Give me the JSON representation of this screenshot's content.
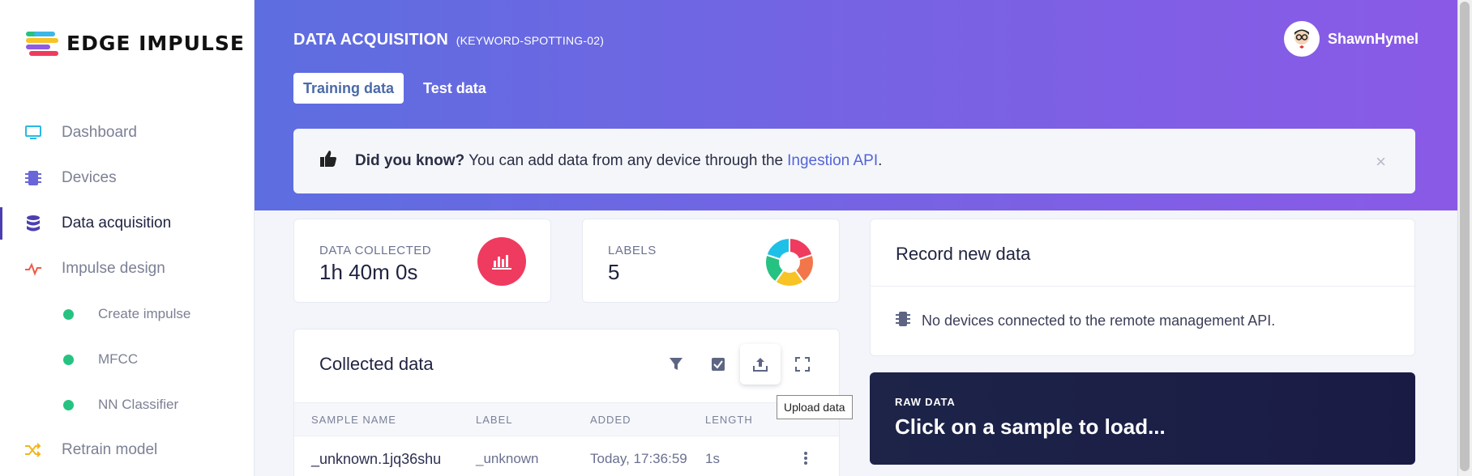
{
  "brand": {
    "name": "EDGE IMPULSE"
  },
  "sidebar": {
    "items": [
      {
        "label": "Dashboard",
        "icon": "monitor-icon"
      },
      {
        "label": "Devices",
        "icon": "chip-icon"
      },
      {
        "label": "Data acquisition",
        "icon": "database-icon",
        "active": true
      },
      {
        "label": "Impulse design",
        "icon": "pulse-icon"
      },
      {
        "label": "Retrain model",
        "icon": "shuffle-icon"
      }
    ],
    "sub_items": [
      {
        "label": "Create impulse"
      },
      {
        "label": "MFCC"
      },
      {
        "label": "NN Classifier"
      }
    ]
  },
  "header": {
    "title": "DATA ACQUISITION",
    "project": "(KEYWORD-SPOTTING-02)",
    "user": "ShawnHymel",
    "tabs": [
      {
        "label": "Training data",
        "active": true
      },
      {
        "label": "Test data",
        "active": false
      }
    ]
  },
  "tip": {
    "bold": "Did you know?",
    "text": "You can add data from any device through the",
    "link": "Ingestion API",
    "end": ".",
    "close": "×"
  },
  "stats": {
    "collected_label": "DATA COLLECTED",
    "collected_value": "1h 40m 0s",
    "labels_label": "LABELS",
    "labels_value": "5"
  },
  "record": {
    "title": "Record new data",
    "message": "No devices connected to the remote management API."
  },
  "raw": {
    "label": "RAW DATA",
    "title": "Click on a sample to load..."
  },
  "collected": {
    "title": "Collected data",
    "tooltip": "Upload data",
    "columns": [
      "SAMPLE NAME",
      "LABEL",
      "ADDED",
      "LENGTH"
    ],
    "rows": [
      {
        "name": "_unknown.1jq36shu",
        "label": "_unknown",
        "added": "Today, 17:36:59",
        "length": "1s"
      }
    ]
  },
  "colors": {
    "header_start": "#5d6ee0",
    "header_end": "#8a5ae6",
    "accent_red": "#ef3b5f",
    "status_green": "#26c281",
    "raw_bg": "#1d2448"
  }
}
